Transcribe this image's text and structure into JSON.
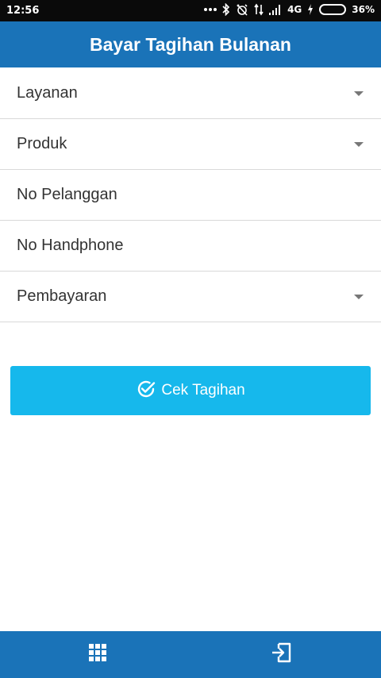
{
  "status_bar": {
    "time": "12:56",
    "network": "4G",
    "battery_percent": "36%",
    "battery_level": 0.36
  },
  "header": {
    "title": "Bayar Tagihan Bulanan"
  },
  "form": {
    "fields": [
      {
        "label": "Layanan",
        "type": "dropdown"
      },
      {
        "label": "Produk",
        "type": "dropdown"
      },
      {
        "label": "No Pelanggan",
        "type": "input"
      },
      {
        "label": "No Handphone",
        "type": "input"
      },
      {
        "label": "Pembayaran",
        "type": "dropdown"
      }
    ]
  },
  "actions": {
    "check_bill_label": "Cek Tagihan"
  },
  "bottom_nav": {
    "items": [
      "grid-menu-icon",
      "exit-icon"
    ]
  },
  "colors": {
    "app_bar": "#1a73b8",
    "button": "#16b8ec",
    "status_bar": "#0a0a0a"
  }
}
